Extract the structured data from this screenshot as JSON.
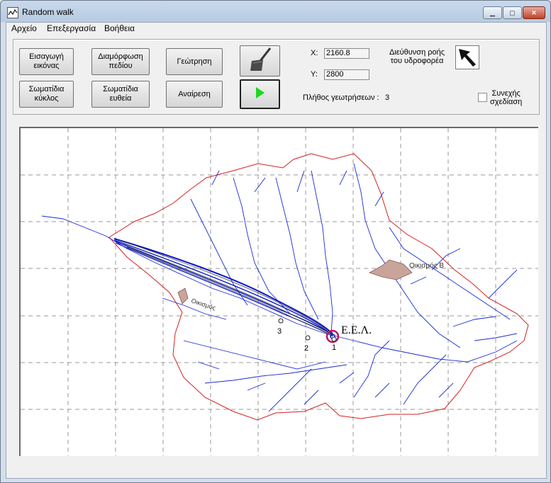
{
  "window": {
    "title": "Random walk"
  },
  "menu": {
    "items": [
      "Αρχείο",
      "Επεξεργασία",
      "Βοήθεια"
    ]
  },
  "toolbar": {
    "import_image": [
      "Εισαγωγή",
      "εικόνας"
    ],
    "field_config": [
      "Διαμόρφωση",
      "πεδίου"
    ],
    "drilling": "Γεώτρηση",
    "particles_circle": [
      "Σωματίδια",
      "κύκλος"
    ],
    "particles_line": [
      "Σωματίδια",
      "ευθεία"
    ],
    "undo": "Αναίρεση"
  },
  "coords": {
    "x_label": "X:",
    "x_value": "2160.8",
    "y_label": "Y:",
    "y_value": "2800"
  },
  "drill_count": {
    "label": "Πλήθος γεωτρήσεων :",
    "value": "3"
  },
  "flow": {
    "label": [
      "Διεύθυνση ροής",
      "του υδροφορέα"
    ]
  },
  "continuous": {
    "label": [
      "Συνεχής",
      "σχεδίαση"
    ]
  },
  "map": {
    "label_eel": "Ε.Ε.Λ.",
    "label_oikismos_b": "Οικισμός Β",
    "label_oikismos_a": "Οικισμός",
    "wells": [
      "1",
      "2",
      "3"
    ]
  },
  "colors": {
    "river": "#1a2bd6",
    "boundary": "#d42020",
    "tracks": "#0a17c8",
    "play": "#1fd61f"
  }
}
